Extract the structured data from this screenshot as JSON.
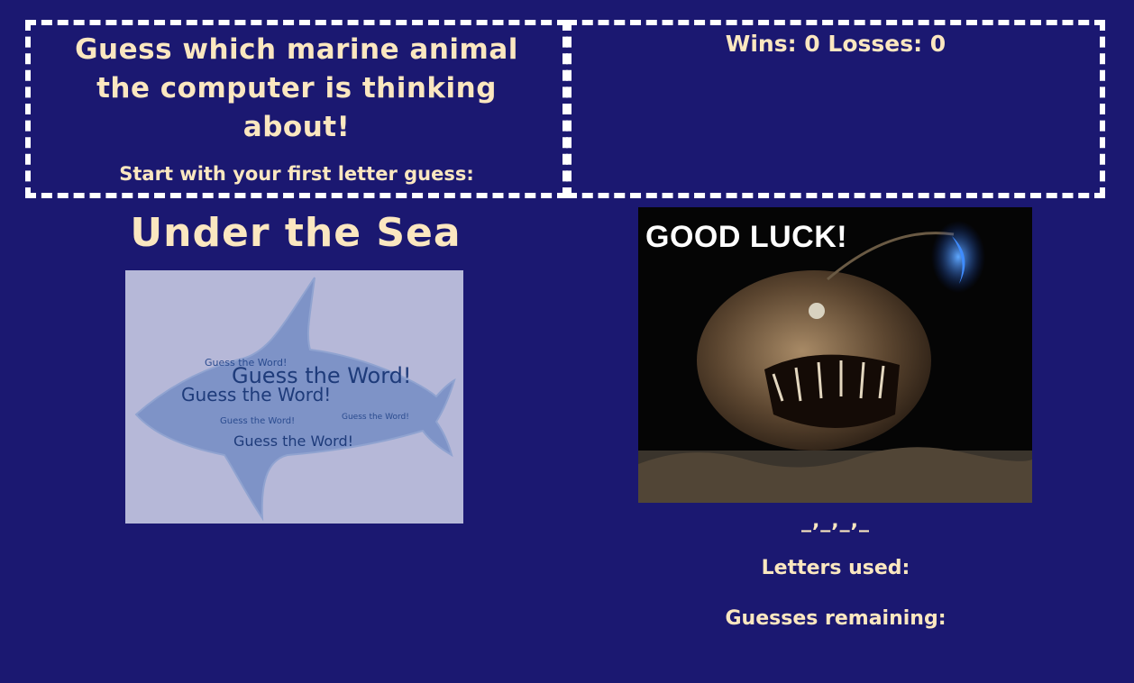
{
  "header": {
    "headline": "Guess which marine animal the computer is thinking about!",
    "prompt": "Start with your first letter guess:"
  },
  "score": {
    "text": "Wins: 0 Losses: 0"
  },
  "title": "Under the Sea",
  "shark_image": {
    "big_text": "Guess the Word!",
    "small_text": "Guess the Word!"
  },
  "angler_image": {
    "caption": "GOOD LUCK!"
  },
  "game": {
    "word_display": "_,_,_,_",
    "letters_used_label": "Letters used:",
    "guesses_remaining_label": "Guesses remaining:"
  },
  "colors": {
    "background": "#1b1871",
    "text": "#fbe7c0",
    "border": "#ffffff"
  }
}
